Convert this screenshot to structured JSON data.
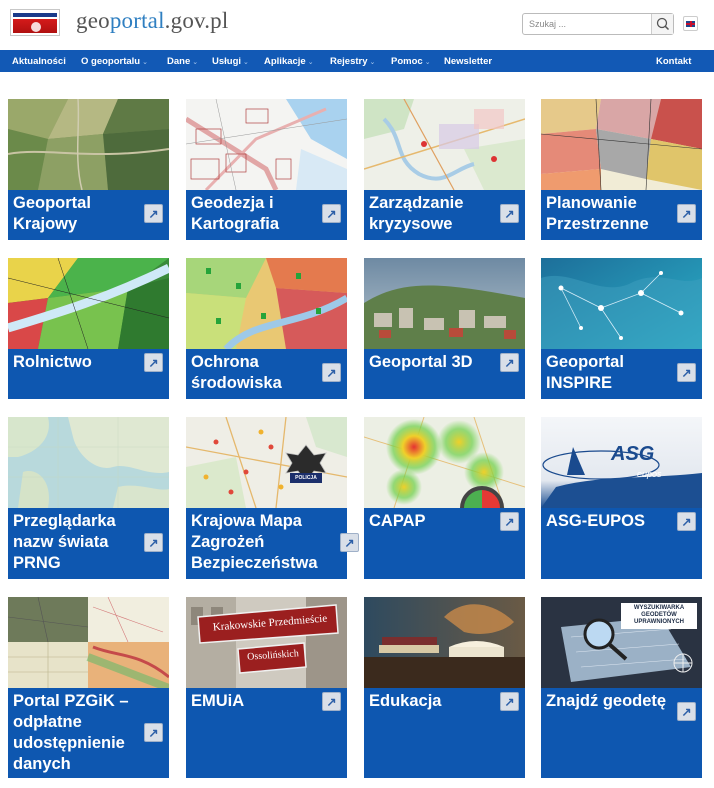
{
  "header": {
    "site_name_prefix": "geo",
    "site_name_accent": "portal",
    "site_name_suffix": ".gov.pl",
    "search_placeholder": "Szukaj ...",
    "search_icon": "search-icon",
    "language_icon": "uk-flag-icon",
    "logo_icon": "glowny-urzad-geodezji-logo"
  },
  "nav": {
    "items": [
      {
        "label": "Aktualności",
        "dropdown": false
      },
      {
        "label": "O geoportalu",
        "dropdown": true
      },
      {
        "label": "Dane",
        "dropdown": true
      },
      {
        "label": "Usługi",
        "dropdown": true
      },
      {
        "label": "Aplikacje",
        "dropdown": true
      },
      {
        "label": "Rejestry",
        "dropdown": true
      },
      {
        "label": "Pomoc",
        "dropdown": true
      },
      {
        "label": "Newsletter",
        "dropdown": false
      }
    ],
    "contact_label": "Kontakt",
    "dropdown_icon": "chevron-down-icon"
  },
  "tiles": [
    {
      "label": "Geoportal Krajowy",
      "image": "orthophoto-map-thumbnail"
    },
    {
      "label": "Geodezja i Kartografia",
      "image": "cadastral-map-thumbnail"
    },
    {
      "label": "Zarządzanie kryzysowe",
      "image": "crisis-map-thumbnail"
    },
    {
      "label": "Planowanie Przestrzenne",
      "image": "zoning-plan-thumbnail"
    },
    {
      "label": "Rolnictwo",
      "image": "agriculture-map-thumbnail"
    },
    {
      "label": "Ochrona środowiska",
      "image": "environment-map-thumbnail"
    },
    {
      "label": "Geoportal 3D",
      "image": "3d-city-thumbnail"
    },
    {
      "label": "Geoportal INSPIRE",
      "image": "inspire-network-thumbnail"
    },
    {
      "label": "Przeglądarka nazw świata PRNG",
      "image": "world-map-thumbnail"
    },
    {
      "label": "Krajowa Mapa Zagrożeń Bezpieczeństwa",
      "image": "police-threat-map-thumbnail",
      "badge_text": "POLICJA"
    },
    {
      "label": "CAPAP",
      "image": "heatmap-thumbnail"
    },
    {
      "label": "ASG-EUPOS",
      "image": "asg-eupos-logo-thumbnail",
      "logo_text": "ASG",
      "logo_sub": "eupos"
    },
    {
      "label": "Portal PZGiK – odpłatne udostępnienie danych",
      "image": "map-mosaic-thumbnail"
    },
    {
      "label": "EMUiA",
      "image": "street-signs-thumbnail",
      "sign1": "Krakowskie Przedmieście",
      "sign2": "Ossolińskich"
    },
    {
      "label": "Edukacja",
      "image": "books-thumbnail"
    },
    {
      "label": "Znajdź geodetę",
      "image": "surveyor-search-thumbnail",
      "panel_text": "WYSZUKIWARKA GEODETÓW UPRAWNIONYCH"
    }
  ],
  "tile_link_icon": "external-link-arrow-icon",
  "tile_link_glyph": "↗"
}
